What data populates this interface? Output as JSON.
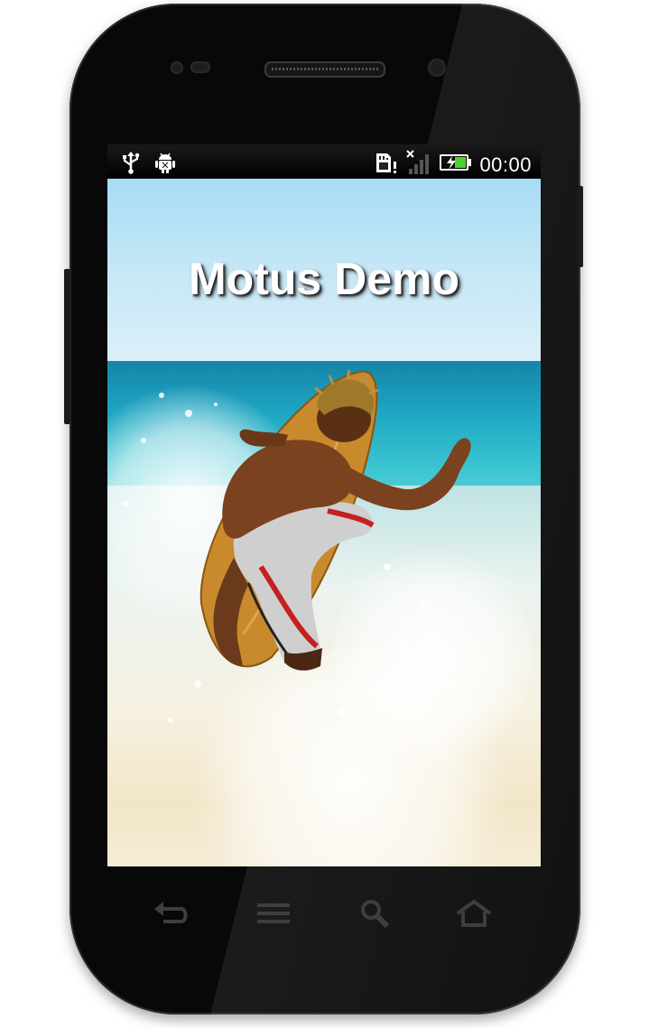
{
  "app": {
    "title": "Motus Demo"
  },
  "status_bar": {
    "time": "00:00",
    "left_icons": [
      "usb-icon",
      "android-debug-icon"
    ],
    "right_icons": [
      "sd-card-warning-icon",
      "signal-off-icon",
      "battery-charging-icon"
    ]
  },
  "navigation_bar": {
    "buttons": [
      "back-icon",
      "menu-icon",
      "search-icon",
      "home-icon"
    ]
  },
  "colors": {
    "phone_body": "#080808",
    "title_text": "#ffffff",
    "nav_icon": "#3e3e3e",
    "battery_fill": "#4cd12b"
  }
}
